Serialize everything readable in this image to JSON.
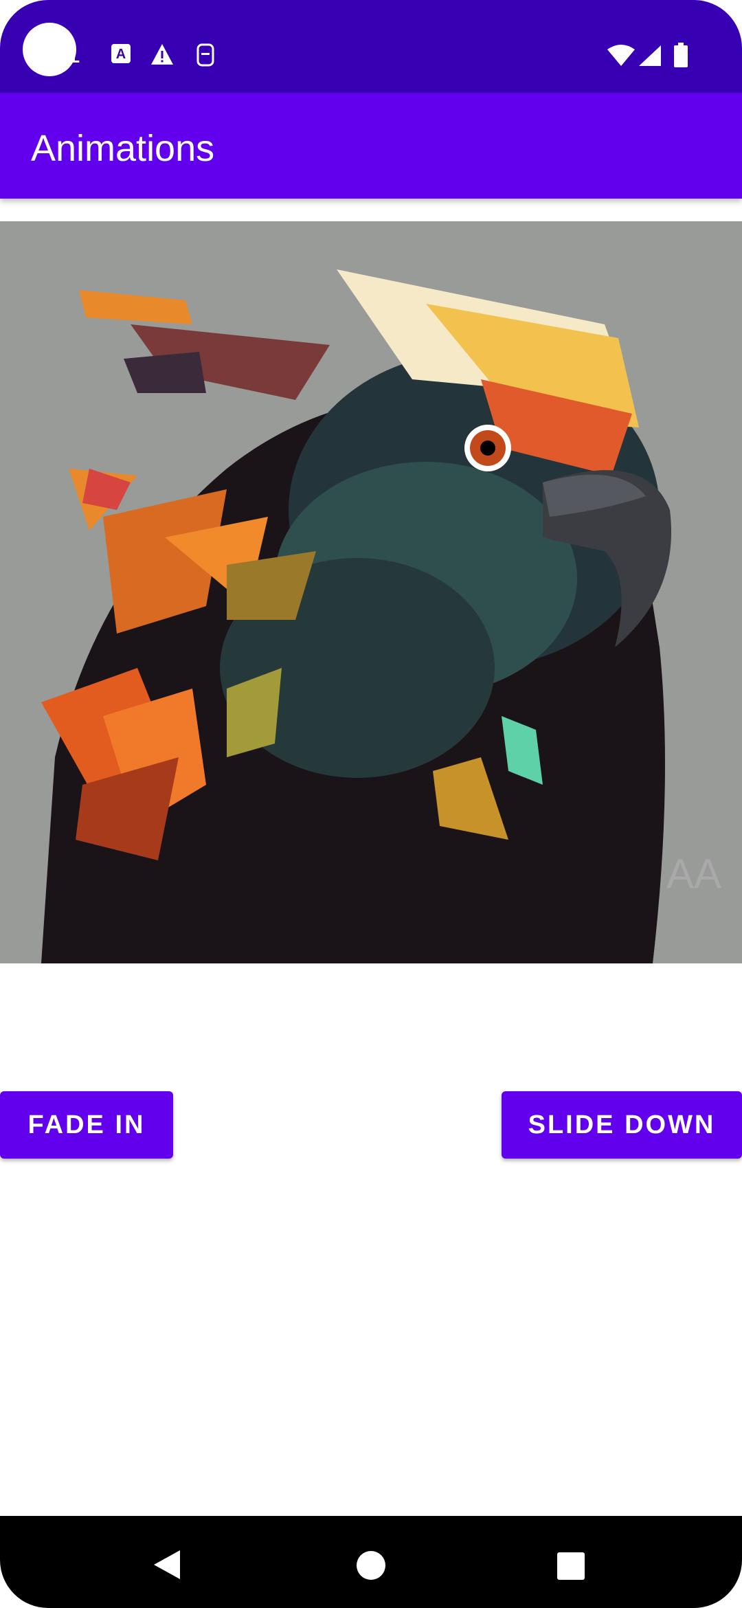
{
  "status_bar": {
    "notification_count": "1",
    "icons": [
      "circle-avatar",
      "text-a-icon",
      "warning-icon",
      "sim-icon",
      "wifi-icon",
      "signal-icon",
      "battery-icon"
    ]
  },
  "app_bar": {
    "title": "Animations"
  },
  "image": {
    "alt_subject": "colorful-parrot-artwork",
    "watermark": "AA"
  },
  "buttons": {
    "fade_in": "FADE IN",
    "slide_down": "SLIDE DOWN"
  },
  "nav_bar": {
    "icons": [
      "back-icon",
      "home-icon",
      "recents-icon"
    ]
  },
  "colors": {
    "status_bar": "#3700B3",
    "primary": "#6200EE",
    "nav": "#000000"
  }
}
